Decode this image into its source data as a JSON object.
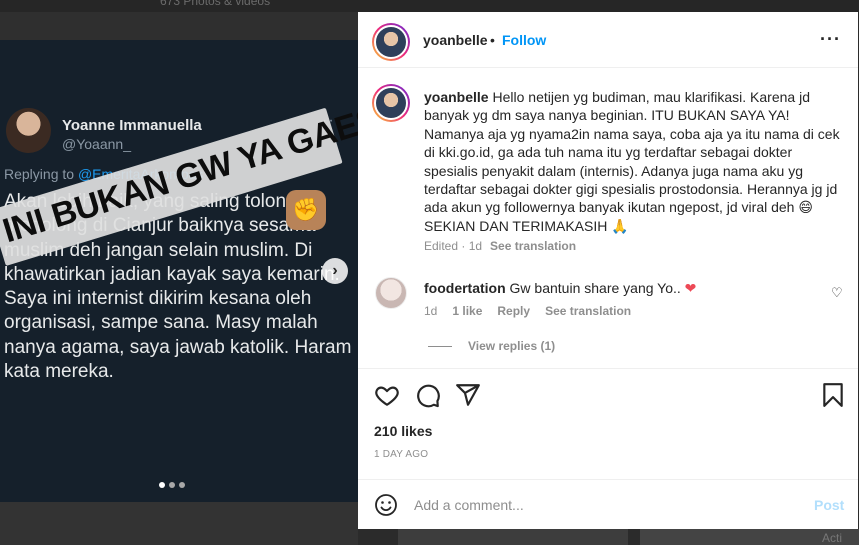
{
  "background": {
    "photo_count_text": "673 Photos & videos",
    "right_edge_text": "Acti"
  },
  "media": {
    "tweet": {
      "display_name": "Yoanne Immanuella",
      "handle": "@Yoaann_",
      "more": "···",
      "replying_prefix": "Replying to ",
      "replying_to": "@EmeritaArkompas",
      "body": "Akan lebih baik, yang saling tolong menolong di Cianjur baiknya sesama muslim deh jangan selain muslim. Di khawatirkan jadian kayak saya kemarin. Saya ini internist dikirim kesana oleh organisasi, sampe sana. Masy malah nanya agama, saya jawab katolik. Haram kata mereka."
    },
    "overlay_text": "INI BUKAN GW YA GAES",
    "overlay_emoji": "✊",
    "next_icon": "chevron-right-icon",
    "next_glyph": "›",
    "carousel": {
      "count": 3,
      "active": 1
    }
  },
  "post": {
    "header": {
      "username": "yoanbelle",
      "separator": "•",
      "follow_label": "Follow",
      "more_label": "···"
    },
    "caption": {
      "username": "yoanbelle",
      "text": "Hello netijen yg budiman, mau klarifikasi. Karena jd banyak yg dm saya nanya beginian. ITU BUKAN SAYA YA! Namanya aja yg nyama2in nama saya, coba aja ya itu nama di cek di kki.go.id, ga ada tuh nama itu yg terdaftar sebagai dokter spesialis penyakit dalam (internis). Adanya juga nama aku yg terdaftar sebagai dokter gigi spesialis prostodonsia. Herannya jg jd ada akun yg followernya banyak ikutan ngepost, jd viral deh 😄 SEKIAN DAN TERIMAKASIH 🙏",
      "meta": "Edited · 1d",
      "see_translation": "See translation"
    },
    "comment": {
      "username": "foodertation",
      "text": "Gw bantuin share yang Yo..",
      "heart": "❤",
      "time": "1d",
      "likes": "1 like",
      "reply": "Reply",
      "see_translation": "See translation",
      "like_icon": "heart-outline-icon",
      "like_glyph": "♡",
      "view_replies": "View replies (1)"
    },
    "actions": {
      "like_icon": "heart-icon",
      "comment_icon": "comment-icon",
      "share_icon": "share-icon",
      "save_icon": "bookmark-icon"
    },
    "likes": "210 likes",
    "date": "1 DAY AGO",
    "add_comment": {
      "emoji_icon": "emoji-icon",
      "placeholder": "Add a comment...",
      "post_label": "Post"
    }
  },
  "colors": {
    "accent": "#0095f6",
    "tweet_bg": "#15202b",
    "heart": "#ed4956"
  }
}
